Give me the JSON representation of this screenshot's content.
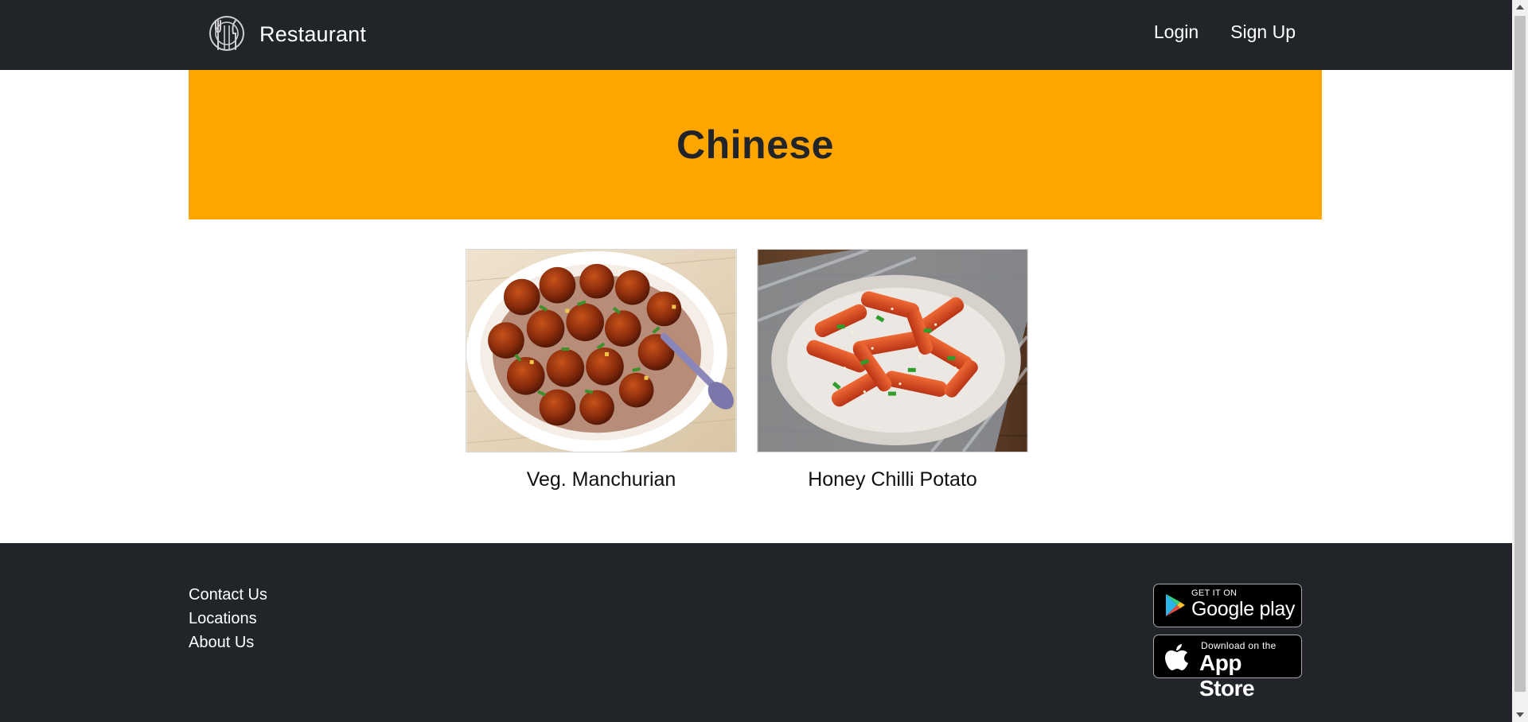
{
  "navbar": {
    "brand": "Restaurant",
    "links": [
      {
        "label": "Login"
      },
      {
        "label": "Sign Up"
      }
    ]
  },
  "hero": {
    "title": "Chinese",
    "background_color": "#ffa500"
  },
  "dishes": [
    {
      "name": "Veg. Manchurian"
    },
    {
      "name": "Honey Chilli Potato"
    }
  ],
  "footer": {
    "links": [
      {
        "label": "Contact Us"
      },
      {
        "label": "Locations"
      },
      {
        "label": "About Us"
      }
    ],
    "badges": {
      "google_play": {
        "small": "GET IT ON",
        "big": "Google play"
      },
      "app_store": {
        "small": "Download on the",
        "big": "App Store"
      }
    }
  },
  "colors": {
    "dark": "#212529",
    "accent": "#ffa500",
    "white": "#ffffff"
  }
}
